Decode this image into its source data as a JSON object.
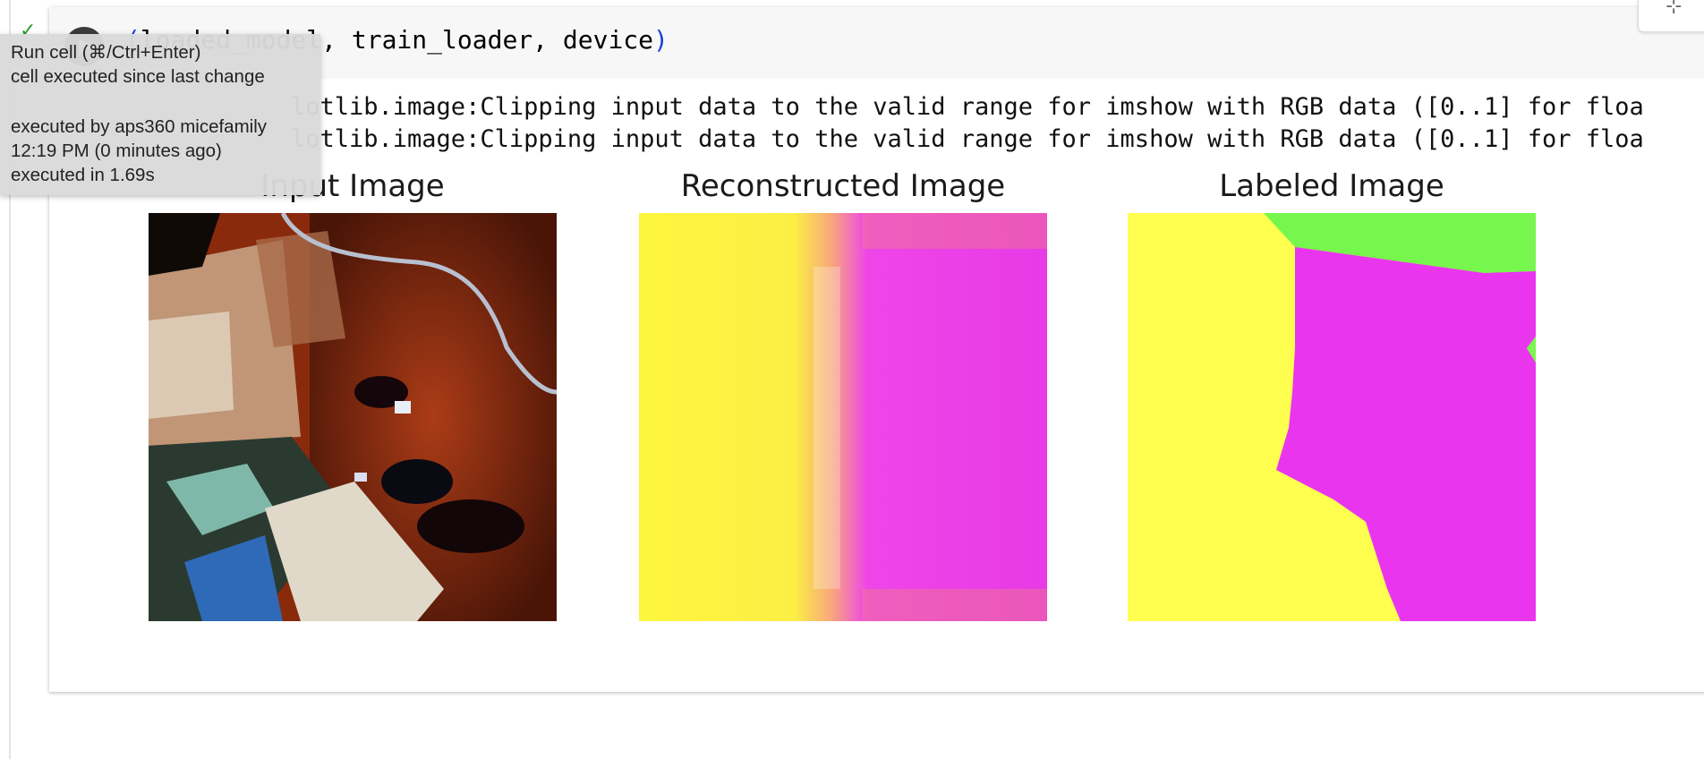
{
  "cell": {
    "code": {
      "func_part": "",
      "open_paren": "(",
      "args": "loaded_model, train_loader, device",
      "close_paren": ")"
    },
    "output_lines": [
      "lotlib.image:Clipping input data to the valid range for imshow with RGB data ([0..1] for floa",
      "lotlib.image:Clipping input data to the valid range for imshow with RGB data ([0..1] for floa"
    ]
  },
  "figure": {
    "panels": [
      {
        "title": "Input Image",
        "image": "satellite-input"
      },
      {
        "title": "Reconstructed Image",
        "image": "reconstructed-yellow-magenta"
      },
      {
        "title": "Labeled Image",
        "image": "labeled-segmentation"
      }
    ]
  },
  "tooltip": {
    "line1": "Run cell (⌘/Ctrl+Enter)",
    "line2": "cell executed since last change",
    "line3": "executed by aps360 micefamily",
    "line4": "12:19 PM (0 minutes ago)",
    "line5": "executed in 1.69s"
  },
  "colors": {
    "yellow": "#ffff50",
    "magenta": "#ea35ef",
    "green": "#77f64d",
    "paren": "#1a3fe0"
  },
  "icons": {
    "run": "play-icon",
    "status": "check-icon",
    "corner": "expand-icon"
  }
}
